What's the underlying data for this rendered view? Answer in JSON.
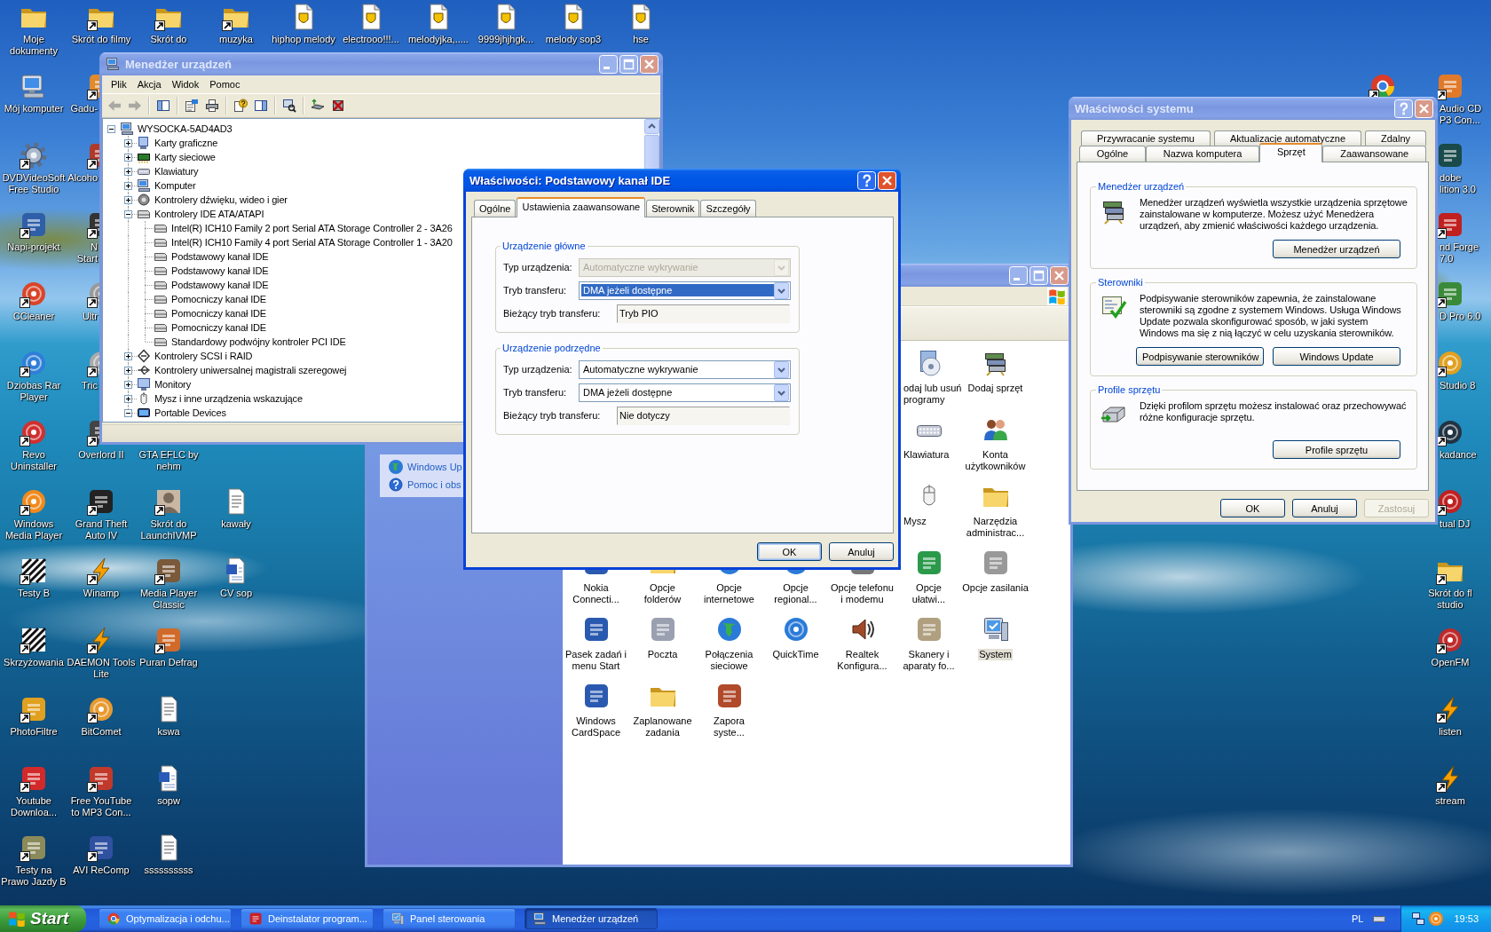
{
  "desktop": {
    "top_row": [
      {
        "label": "Moje\ndokumenty"
      },
      {
        "label": "Skrót do filmy"
      },
      {
        "label": "Skrót do"
      },
      {
        "label": "muzyka"
      },
      {
        "label": "hiphop melody"
      },
      {
        "label": "electrooo!!!..."
      },
      {
        "label": "melodyjka,....."
      },
      {
        "label": "9999jhjhgk..."
      },
      {
        "label": "melody sop3"
      },
      {
        "label": "hse"
      }
    ],
    "columns": [
      {
        "icons": [
          {
            "label": "Mój komputer"
          },
          {
            "label": "DVDVideoSoft\nFree Studio"
          },
          {
            "label": "Napi-projekt"
          },
          {
            "label": "CCleaner"
          },
          {
            "label": "Dziobas Rar\nPlayer"
          },
          {
            "label": "Revo\nUninstaller"
          },
          {
            "label": "Windows\nMedia Player"
          },
          {
            "label": "Testy B"
          },
          {
            "label": "Skrzyżowania"
          },
          {
            "label": "PhotoFiltre"
          },
          {
            "label": "Youtube\nDownloa..."
          },
          {
            "label": "Testy na\nPrawo Jazdy B"
          }
        ]
      },
      {
        "icons": [
          {
            "label": "Gadu-"
          },
          {
            "label": "Alcoho"
          },
          {
            "label": "N\nStart"
          },
          {
            "label": "Ultr"
          },
          {
            "label": "Tric"
          },
          {
            "label": "Overlord II"
          },
          {
            "label": "Grand Theft\nAuto IV"
          },
          {
            "label": "Winamp"
          },
          {
            "label": "DAEMON Tools\nLite"
          },
          {
            "label": "BitComet"
          },
          {
            "label": "Free YouTube\nto MP3 Con..."
          },
          {
            "label": "AVI ReComp"
          }
        ]
      },
      {
        "icons": [
          {
            "label": "GTA EFLC by\nnehm"
          },
          {
            "label": "Skrót do\nLaunchIVMP"
          },
          {
            "label": "Media Player\nClassic"
          },
          {
            "label": "Puran Defrag"
          },
          {
            "label": "kswa"
          },
          {
            "label": "sopw"
          },
          {
            "label": "ssssssssss"
          }
        ]
      },
      {
        "icons": [
          {
            "label": "kawały"
          },
          {
            "label": "CV sop"
          }
        ]
      }
    ],
    "right_column": [
      {
        "label": "Audio CD\nP3 Con..."
      },
      {
        "label": "dobe\nlition 3.0"
      },
      {
        "label": "nd Forge\n7.0"
      },
      {
        "label": "D Pro 6.0"
      },
      {
        "label": "Studio 8"
      },
      {
        "label": "kadance"
      },
      {
        "label": "tual DJ"
      },
      {
        "label": "Skrót do fl\nstudio"
      },
      {
        "label": "OpenFM"
      },
      {
        "label": "listen"
      },
      {
        "label": "stream"
      }
    ]
  },
  "device_manager": {
    "title": "Menedżer urządzeń",
    "active": false,
    "menu": [
      "Plik",
      "Akcja",
      "Widok",
      "Pomoc"
    ],
    "toolbar": [
      {
        "disabled": true
      },
      {
        "disabled": true
      },
      {
        "disabled": false
      },
      {
        "disabled": false
      },
      {
        "disabled": false
      },
      {
        "disabled": false
      },
      {
        "disabled": false
      },
      {
        "disabled": false
      },
      {
        "disabled": false
      },
      {
        "disabled": false
      }
    ],
    "tree": {
      "label": "WYSOCKA-5AD4AD3",
      "expanded": true,
      "children": [
        {
          "label": "Karty graficzne",
          "expanded": false
        },
        {
          "label": "Karty sieciowe",
          "expanded": false
        },
        {
          "label": "Klawiatury",
          "expanded": false
        },
        {
          "label": "Komputer",
          "expanded": false
        },
        {
          "label": "Kontrolery dźwięku, wideo i gier",
          "expanded": false
        },
        {
          "label": "Kontrolery IDE ATA/ATAPI",
          "expanded": true,
          "children": [
            {
              "label": "Intel(R) ICH10 Family 2 port Serial ATA Storage Controller 2 - 3A26"
            },
            {
              "label": "Intel(R) ICH10 Family 4 port Serial ATA Storage Controller 1 - 3A20"
            },
            {
              "label": "Podstawowy kanał IDE"
            },
            {
              "label": "Podstawowy kanał IDE"
            },
            {
              "label": "Podstawowy kanał IDE"
            },
            {
              "label": "Pomocniczy kanał IDE"
            },
            {
              "label": "Pomocniczy kanał IDE"
            },
            {
              "label": "Pomocniczy kanał IDE"
            },
            {
              "label": "Standardowy podwójny kontroler PCI IDE"
            }
          ]
        },
        {
          "label": "Kontrolery SCSI i RAID",
          "expanded": false
        },
        {
          "label": "Kontrolery uniwersalnej magistrali szeregowej",
          "expanded": false
        },
        {
          "label": "Monitory",
          "expanded": false
        },
        {
          "label": "Mysz i inne urządzenia wskazujące",
          "expanded": false
        },
        {
          "label": "Portable Devices",
          "expanded": true
        }
      ]
    }
  },
  "ide_dialog": {
    "title": "Właściwości: Podstawowy kanał IDE",
    "active": true,
    "tabs": [
      {
        "label": "Ogólne",
        "selected": false
      },
      {
        "label": "Ustawienia zaawansowane",
        "selected": true
      },
      {
        "label": "Sterownik",
        "selected": false
      },
      {
        "label": "Szczegóły",
        "selected": false
      }
    ],
    "groups": [
      {
        "title": "Urządzenie główne",
        "fields": [
          {
            "label": "Typ urządzenia:",
            "kind": "dropdown",
            "value": "Automatyczne wykrywanie",
            "disabled": true,
            "focused": false
          },
          {
            "label": "Tryb transferu:",
            "kind": "dropdown",
            "value": "DMA jeżeli dostępne",
            "disabled": false,
            "focused": true
          },
          {
            "label": "Bieżący tryb transferu:",
            "kind": "readonly",
            "value": "Tryb PIO",
            "disabled": false,
            "focused": false
          }
        ]
      },
      {
        "title": "Urządzenie podrzędne",
        "fields": [
          {
            "label": "Typ urządzenia:",
            "kind": "dropdown",
            "value": "Automatyczne wykrywanie",
            "disabled": false,
            "focused": false
          },
          {
            "label": "Tryb transferu:",
            "kind": "dropdown",
            "value": "DMA jeżeli dostępne",
            "disabled": false,
            "focused": false
          },
          {
            "label": "Bieżący tryb transferu:",
            "kind": "readonly",
            "value": "Nie dotyczy",
            "disabled": false,
            "focused": false
          }
        ]
      }
    ],
    "buttons": [
      {
        "label": "OK",
        "default": true
      },
      {
        "label": "Anuluj",
        "default": false
      }
    ]
  },
  "control_panel": {
    "active": false,
    "see_also": [
      "Windows Up",
      "Pomoc i obs"
    ],
    "items": [
      {
        "label": "odaj lub usuń\nprogramy",
        "selected": false
      },
      {
        "label": "Dodaj sprzęt",
        "selected": false
      },
      {
        "label": "Klawiatura",
        "selected": false
      },
      {
        "label": "Konta\nużytkowników",
        "selected": false
      },
      {
        "label": "Mysz",
        "selected": false
      },
      {
        "label": "Narzędzia\nadministrac...",
        "selected": false
      },
      {
        "label": "Nokia\nConnecti...",
        "selected": false
      },
      {
        "label": "Opcje\nfolderów",
        "selected": false
      },
      {
        "label": "Opcje\ninternetowe",
        "selected": false
      },
      {
        "label": "Opcje\nregional...",
        "selected": false
      },
      {
        "label": "Opcje telefonu\ni modemu",
        "selected": false
      },
      {
        "label": "Opcje\nułatwi...",
        "selected": false
      },
      {
        "label": "Opcje zasilania",
        "selected": false
      },
      {
        "label": "Pasek zadań i\nmenu Start",
        "selected": false
      },
      {
        "label": "Poczta",
        "selected": false
      },
      {
        "label": "Połączenia\nsieciowe",
        "selected": false
      },
      {
        "label": "QuickTime",
        "selected": false
      },
      {
        "label": "Realtek\nKonfigura...",
        "selected": false
      },
      {
        "label": "Skanery i\naparaty fo...",
        "selected": false
      },
      {
        "label": "System",
        "selected": true
      },
      {
        "label": "Windows\nCardSpace",
        "selected": false
      },
      {
        "label": "Zaplanowane\nzadania",
        "selected": false
      },
      {
        "label": "Zapora\nsyste...",
        "selected": false
      }
    ]
  },
  "system_properties": {
    "title": "Właściwości systemu",
    "active": false,
    "tab_rows": [
      {
        "tabs": [
          {
            "label": "Przywracanie systemu",
            "selected": false
          },
          {
            "label": "Aktualizacje automatyczne",
            "selected": false
          },
          {
            "label": "Zdalny",
            "selected": false
          }
        ]
      },
      {
        "tabs": [
          {
            "label": "Ogólne",
            "selected": false
          },
          {
            "label": "Nazwa komputera",
            "selected": false
          },
          {
            "label": "Sprzęt",
            "selected": true
          },
          {
            "label": "Zaawansowane",
            "selected": false
          }
        ]
      }
    ],
    "groups": [
      {
        "title": "Menedżer urządzeń",
        "text": "Menedżer urządzeń wyświetla wszystkie urządzenia sprzętowe\nzainstalowane w komputerze. Możesz użyć Menedżera\nurządzeń, aby zmienić właściwości każdego urządzenia.",
        "buttons": [
          "Menedżer urządzeń"
        ]
      },
      {
        "title": "Sterowniki",
        "text": "Podpisywanie sterowników zapewnia, że zainstalowane\nsterowniki są zgodne z systemem Windows. Usługa Windows\nUpdate pozwala skonfigurować sposób, w jaki system\nWindows ma się z nią łączyć w celu uzyskania sterowników.",
        "buttons": [
          "Podpisywanie sterowników",
          "Windows Update"
        ]
      },
      {
        "title": "Profile sprzętu",
        "text": "Dzięki profilom sprzętu możesz instalować oraz przechowywać\nróżne konfiguracje sprzętu.",
        "buttons": [
          "Profile sprzętu"
        ]
      }
    ],
    "buttons": [
      {
        "label": "OK",
        "disabled": false
      },
      {
        "label": "Anuluj",
        "disabled": false
      },
      {
        "label": "Zastosuj",
        "disabled": true
      }
    ]
  },
  "taskbar": {
    "start": "Start",
    "tasks": [
      {
        "label": "Optymalizacja i odchu...",
        "selected": false
      },
      {
        "label": "Deinstalator program...",
        "selected": false
      },
      {
        "label": "Panel sterowania",
        "selected": false
      },
      {
        "label": "Menedżer urządzeń",
        "selected": true
      }
    ],
    "language": "PL",
    "clock": "19:53"
  }
}
